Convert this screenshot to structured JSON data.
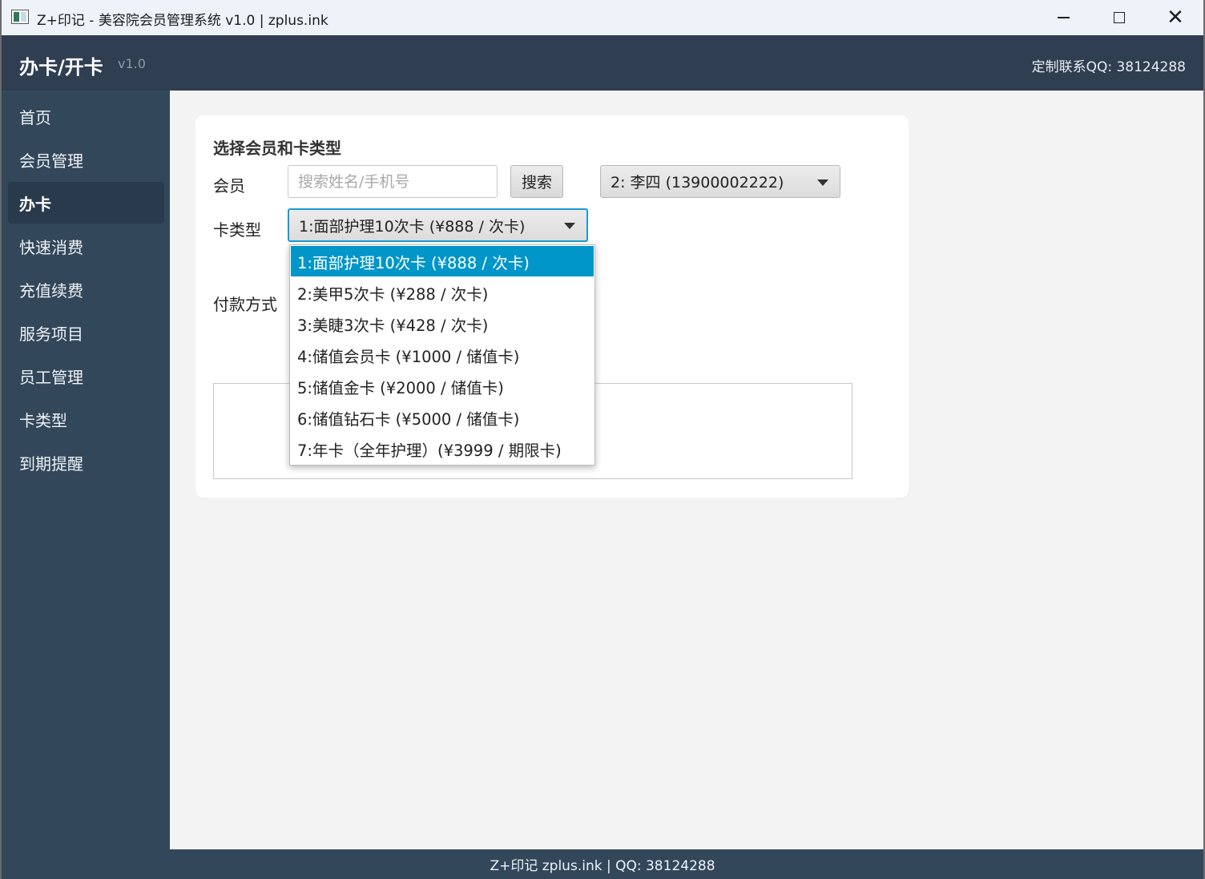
{
  "window": {
    "title": "Z+印记 - 美容院会员管理系统 v1.0 | zplus.ink",
    "controls": {
      "minimize": "minimize-icon",
      "maximize": "maximize-icon",
      "close": "✕"
    }
  },
  "header": {
    "title": "办卡/开卡",
    "version": "v1.0",
    "contact": "定制联系QQ: 38124288"
  },
  "sidebar": {
    "items": [
      {
        "label": "首页"
      },
      {
        "label": "会员管理"
      },
      {
        "label": "办卡",
        "active": true
      },
      {
        "label": "快速消费"
      },
      {
        "label": "充值续费"
      },
      {
        "label": "服务项目"
      },
      {
        "label": "员工管理"
      },
      {
        "label": "卡类型"
      },
      {
        "label": "到期提醒"
      }
    ]
  },
  "form": {
    "section_title": "选择会员和卡类型",
    "member_label": "会员",
    "search_placeholder": "搜索姓名/手机号",
    "search_value": "",
    "search_button": "搜索",
    "member_selected": "2: 李四 (13900002222)",
    "card_type_label": "卡类型",
    "card_type_selected": "1:面部护理10次卡 (¥888 / 次卡)",
    "payment_label": "付款方式"
  },
  "dropdown": {
    "options": [
      "1:面部护理10次卡 (¥888 / 次卡)",
      "2:美甲5次卡 (¥288 / 次卡)",
      "3:美睫3次卡 (¥428 / 次卡)",
      "4:储值会员卡 (¥1000 / 储值卡)",
      "5:储值金卡 (¥2000 / 储值卡)",
      "6:储值钻石卡 (¥5000 / 储值卡)",
      "7:年卡（全年护理）(¥3999 / 期限卡)"
    ],
    "selected_index": 0
  },
  "statusbar": {
    "text": "Z+印记 zplus.ink | QQ: 38124288"
  },
  "colors": {
    "header_bg": "#2f3e50",
    "sidebar_bg": "#33475b",
    "accent": "#0096c9",
    "focus_border": "#1b9ad6"
  }
}
